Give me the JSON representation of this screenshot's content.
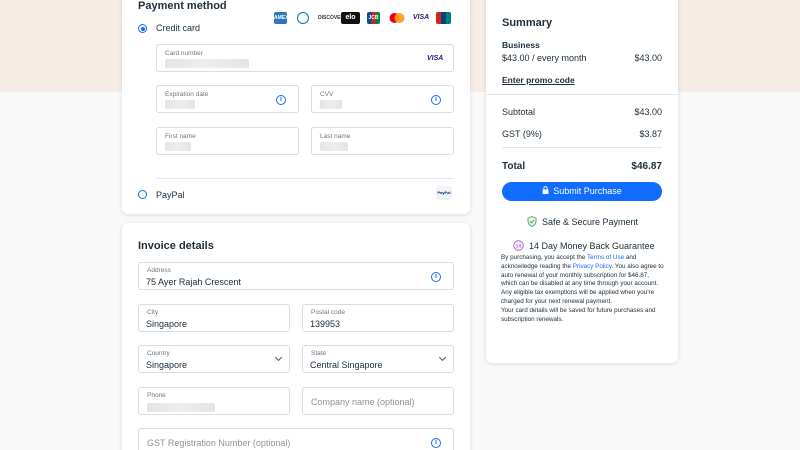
{
  "payment": {
    "title": "Payment method",
    "credit_label": "Credit card",
    "card_number_label": "Card number",
    "card_badge": "VISA",
    "expiration_label": "Expiration date",
    "cvv_label": "CVV",
    "first_name_label": "First name",
    "last_name_label": "Last name",
    "paypal_label": "PayPal",
    "paypal_badge": "PayPal",
    "logos": [
      "AMEX",
      "Diners",
      "DISCOVER",
      "elo",
      "JCB",
      "Mastercard",
      "VISA",
      "UnionPay"
    ]
  },
  "invoice": {
    "title": "Invoice details",
    "address_label": "Address",
    "address_value": "75 Ayer Rajah Crescent",
    "city_label": "City",
    "city_value": "Singapore",
    "postal_label": "Postal code",
    "postal_value": "139953",
    "country_label": "Country",
    "country_value": "Singapore",
    "state_label": "State",
    "state_value": "Central Singapore",
    "phone_label": "Phone",
    "company_placeholder": "Company name (optional)",
    "gst_placeholder": "GST Registration Number (optional)"
  },
  "summary": {
    "title": "Summary",
    "plan_name": "Business",
    "plan_price": "$43.00 / every month",
    "plan_amount": "$43.00",
    "promo": "Enter promo code",
    "subtotal_label": "Subtotal",
    "subtotal_value": "$43.00",
    "gst_label": "GST (9%)",
    "gst_value": "$3.87",
    "total_label": "Total",
    "total_value": "$46.87",
    "submit_label": "Submit Purchase",
    "secure_label": "Safe & Secure Payment",
    "guarantee_label": "14 Day Money Back Guarantee",
    "fine_1": "By purchasing, you accept the ",
    "terms_link": "Terms of Use",
    "fine_2": " and acknowledge reading the ",
    "privacy_link": "Privacy Policy",
    "fine_3": ". You also agree to auto renewal of your monthly subscription for $46.87, which can be disabled at any time through your account. Any eligible tax exemptions will be applied when you're charged for your next renewal payment.",
    "fine_4": "Your card details will be saved for future purchases and subscription renewals."
  },
  "colors": {
    "accent": "#116dff",
    "header_bg": "#f7ece5"
  }
}
